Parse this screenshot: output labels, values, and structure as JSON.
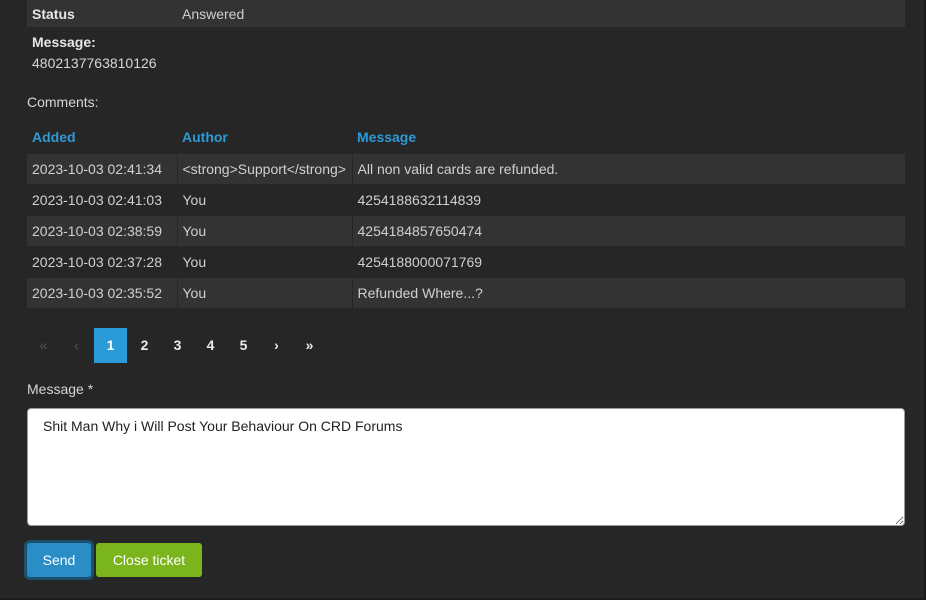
{
  "ticket": {
    "status_label": "Status",
    "status_value": "Answered",
    "message_label": "Message:",
    "message_value": "4802137763810126"
  },
  "comments": {
    "label": "Comments:",
    "headers": [
      "Added",
      "Author",
      "Message"
    ],
    "rows": [
      {
        "added": "2023-10-03 02:41:34",
        "author": "<strong>Support</strong>",
        "message": "All non valid cards are refunded."
      },
      {
        "added": "2023-10-03 02:41:03",
        "author": "You",
        "message": "4254188632114839"
      },
      {
        "added": "2023-10-03 02:38:59",
        "author": "You",
        "message": "4254184857650474"
      },
      {
        "added": "2023-10-03 02:37:28",
        "author": "You",
        "message": "4254188000071769"
      },
      {
        "added": "2023-10-03 02:35:52",
        "author": "You",
        "message": "Refunded Where...?"
      }
    ]
  },
  "pagination": {
    "first": "«",
    "prev": "‹",
    "pages": [
      "1",
      "2",
      "3",
      "4",
      "5"
    ],
    "next": "›",
    "last": "»",
    "current": "1"
  },
  "reply": {
    "label": "Message *",
    "value": "Shit Man Why i Will Post Your Behaviour On CRD Forums"
  },
  "actions": {
    "send": "Send",
    "close": "Close ticket"
  }
}
